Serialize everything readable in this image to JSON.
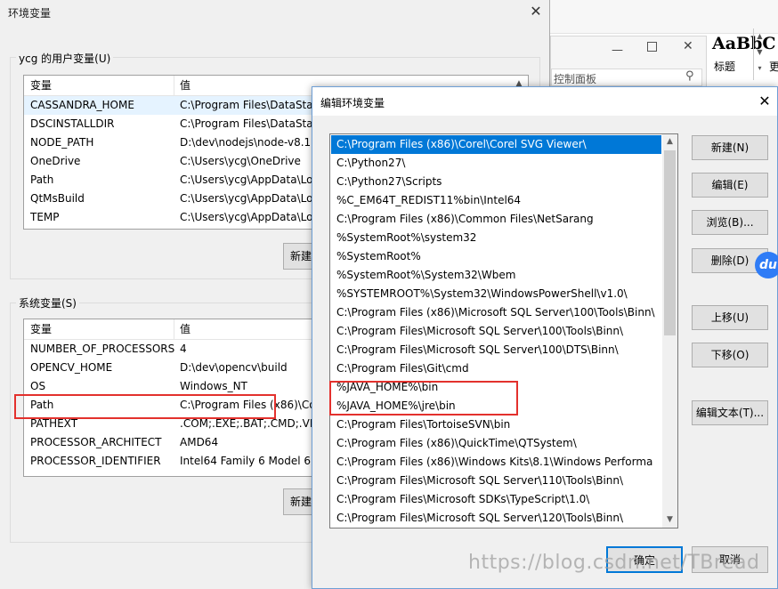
{
  "env_window": {
    "title": "环境变量",
    "user_group_label": "ycg 的用户变量(U)",
    "system_group_label": "系统变量(S)",
    "col_var": "变量",
    "col_val": "值",
    "user_vars": [
      {
        "name": "CASSANDRA_HOME",
        "value": "C:\\Program Files\\DataSta"
      },
      {
        "name": "DSCINSTALLDIR",
        "value": "C:\\Program Files\\DataSta"
      },
      {
        "name": "NODE_PATH",
        "value": "D:\\dev\\nodejs\\node-v8.1"
      },
      {
        "name": "OneDrive",
        "value": "C:\\Users\\ycg\\OneDrive"
      },
      {
        "name": "Path",
        "value": "C:\\Users\\ycg\\AppData\\Lo"
      },
      {
        "name": "QtMsBuild",
        "value": "C:\\Users\\ycg\\AppData\\Lo"
      },
      {
        "name": "TEMP",
        "value": "C:\\Users\\ycg\\AppData\\Lo"
      }
    ],
    "system_vars": [
      {
        "name": "NUMBER_OF_PROCESSORS",
        "value": "4"
      },
      {
        "name": "OPENCV_HOME",
        "value": "D:\\dev\\opencv\\build"
      },
      {
        "name": "OS",
        "value": "Windows_NT"
      },
      {
        "name": "Path",
        "value": "C:\\Program Files (x86)\\Co"
      },
      {
        "name": "PATHEXT",
        "value": ".COM;.EXE;.BAT;.CMD;.VB"
      },
      {
        "name": "PROCESSOR_ARCHITECT",
        "value": "AMD64"
      },
      {
        "name": "PROCESSOR_IDENTIFIER",
        "value": "Intel64 Family 6 Model 61"
      }
    ],
    "new_user_button": "新建",
    "new_system_button": "新建"
  },
  "control_panel": {
    "search_placeholder": "控制面板",
    "style_sample": "AaBbC",
    "style_label": "标题",
    "more": "更"
  },
  "edit_dialog": {
    "title": "编辑环境变量",
    "paths": [
      "C:\\Program Files (x86)\\Corel\\Corel SVG Viewer\\",
      "C:\\Python27\\",
      "C:\\Python27\\Scripts",
      "%C_EM64T_REDIST11%bin\\Intel64",
      "C:\\Program Files (x86)\\Common Files\\NetSarang",
      "%SystemRoot%\\system32",
      "%SystemRoot%",
      "%SystemRoot%\\System32\\Wbem",
      "%SYSTEMROOT%\\System32\\WindowsPowerShell\\v1.0\\",
      "C:\\Program Files (x86)\\Microsoft SQL Server\\100\\Tools\\Binn\\",
      "C:\\Program Files\\Microsoft SQL Server\\100\\Tools\\Binn\\",
      "C:\\Program Files\\Microsoft SQL Server\\100\\DTS\\Binn\\",
      "C:\\Program Files\\Git\\cmd",
      "%JAVA_HOME%\\bin",
      "%JAVA_HOME%\\jre\\bin",
      "C:\\Program Files\\TortoiseSVN\\bin",
      "C:\\Program Files (x86)\\QuickTime\\QTSystem\\",
      "C:\\Program Files (x86)\\Windows Kits\\8.1\\Windows Performa",
      "C:\\Program Files\\Microsoft SQL Server\\110\\Tools\\Binn\\",
      "C:\\Program Files\\Microsoft SDKs\\TypeScript\\1.0\\",
      "C:\\Program Files\\Microsoft SQL Server\\120\\Tools\\Binn\\"
    ],
    "buttons": {
      "new": "新建(N)",
      "edit": "编辑(E)",
      "browse": "浏览(B)...",
      "delete": "删除(D)",
      "move_up": "上移(U)",
      "move_down": "下移(O)",
      "edit_text": "编辑文本(T)...",
      "ok": "确定",
      "cancel": "取消"
    }
  },
  "watermark": "https://blog.csdn.net/TBread",
  "badge": "du",
  "colors": {
    "selection": "#0078d7",
    "highlight_box": "#e3312d"
  }
}
